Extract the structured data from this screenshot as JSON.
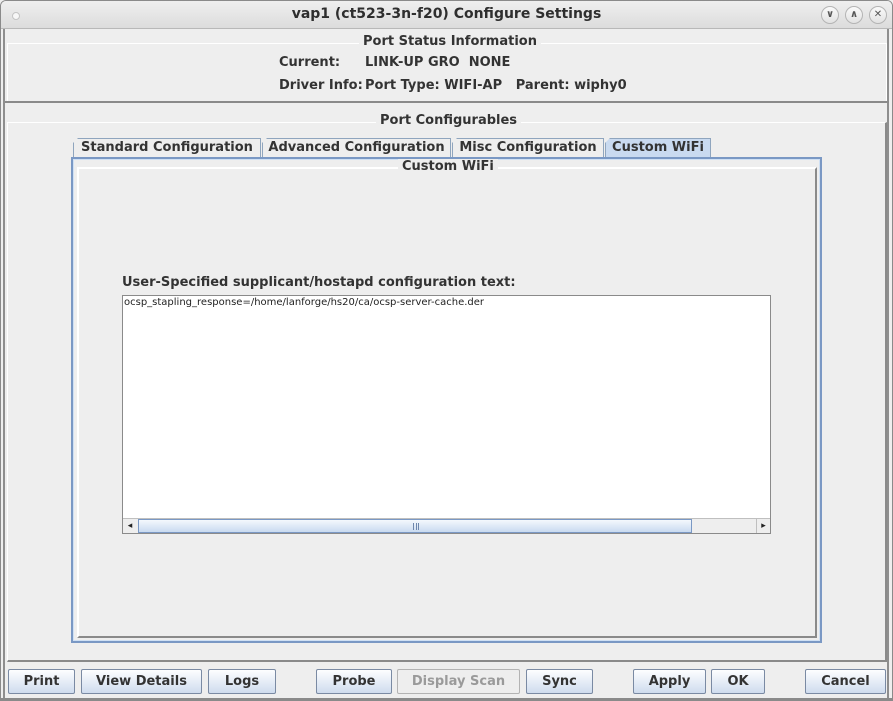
{
  "window": {
    "title": "vap1  (ct523-3n-f20) Configure Settings",
    "controls": {
      "minimize": "∨",
      "maximize": "∧",
      "close": "✕"
    }
  },
  "status": {
    "title": "Port Status Information",
    "current_label": "Current:",
    "current_value": "LINK-UP GRO  NONE",
    "driver_label": "Driver Info:",
    "driver_value": "Port Type: WIFI-AP   Parent: wiphy0"
  },
  "configurables": {
    "title": "Port Configurables",
    "tabs": [
      {
        "label": "Standard Configuration",
        "active": false
      },
      {
        "label": "Advanced Configuration",
        "active": false
      },
      {
        "label": "Misc Configuration",
        "active": false
      },
      {
        "label": "Custom WiFi",
        "active": true
      }
    ],
    "custom_wifi": {
      "panel_title": "Custom WiFi",
      "text_label": "User-Specified supplicant/hostapd configuration text:",
      "text_value": "ocsp_stapling_response=/home/lanforge/hs20/ca/ocsp-server-cache.der"
    }
  },
  "buttons": {
    "print": "Print",
    "view_details": "View Details",
    "logs": "Logs",
    "probe": "Probe",
    "display_scan": "Display Scan",
    "sync": "Sync",
    "apply": "Apply",
    "ok": "OK",
    "cancel": "Cancel"
  },
  "scroll": {
    "left_arrow": "◂",
    "right_arrow": "▸"
  }
}
